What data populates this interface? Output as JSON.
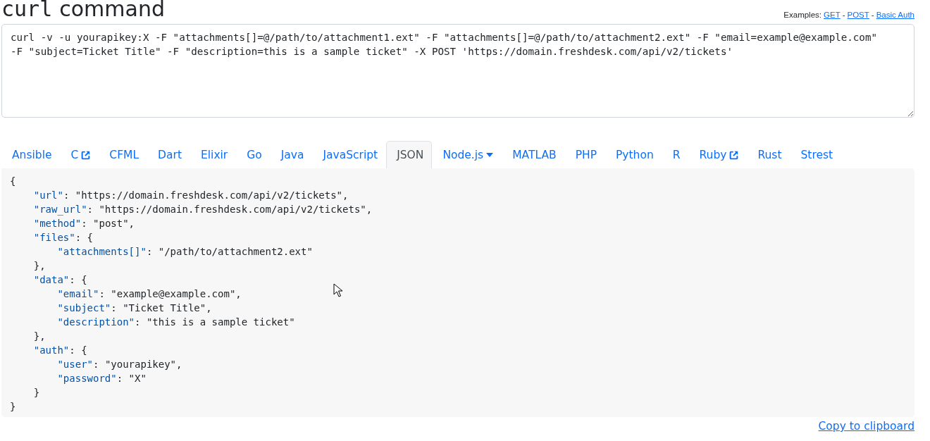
{
  "title": {
    "code": "curl",
    "text": "command"
  },
  "examples": {
    "label": "Examples:",
    "links": [
      "GET",
      "POST",
      "Basic Auth"
    ],
    "separator": "-"
  },
  "command": {
    "value": "curl -v -u yourapikey:X -F \"attachments[]=@/path/to/attachment1.ext\" -F \"attachments[]=@/path/to/attachment2.ext\" -F \"email=example@example.com\" -F \"subject=Ticket Title\" -F \"description=this is a sample ticket\" -X POST 'https://domain.freshdesk.com/api/v2/tickets'"
  },
  "tabs": [
    {
      "label": "Ansible",
      "kind": "plain",
      "selected": false
    },
    {
      "label": "C",
      "kind": "external",
      "selected": false
    },
    {
      "label": "CFML",
      "kind": "plain",
      "selected": false
    },
    {
      "label": "Dart",
      "kind": "plain",
      "selected": false
    },
    {
      "label": "Elixir",
      "kind": "plain",
      "selected": false
    },
    {
      "label": "Go",
      "kind": "plain",
      "selected": false
    },
    {
      "label": "Java",
      "kind": "plain",
      "selected": false
    },
    {
      "label": "JavaScript",
      "kind": "plain",
      "selected": false
    },
    {
      "label": "JSON",
      "kind": "plain",
      "selected": true
    },
    {
      "label": "Node.js",
      "kind": "dropdown",
      "selected": false
    },
    {
      "label": "MATLAB",
      "kind": "plain",
      "selected": false
    },
    {
      "label": "PHP",
      "kind": "plain",
      "selected": false
    },
    {
      "label": "Python",
      "kind": "plain",
      "selected": false
    },
    {
      "label": "R",
      "kind": "plain",
      "selected": false
    },
    {
      "label": "Ruby",
      "kind": "external",
      "selected": false
    },
    {
      "label": "Rust",
      "kind": "plain",
      "selected": false
    },
    {
      "label": "Strest",
      "kind": "plain",
      "selected": false
    }
  ],
  "output": {
    "code": "{\n    \"url\": \"https://domain.freshdesk.com/api/v2/tickets\",\n    \"raw_url\": \"https://domain.freshdesk.com/api/v2/tickets\",\n    \"method\": \"post\",\n    \"files\": {\n        \"attachments[]\": \"/path/to/attachment2.ext\"\n    },\n    \"data\": {\n        \"email\": \"example@example.com\",\n        \"subject\": \"Ticket Title\",\n        \"description\": \"this is a sample ticket\"\n    },\n    \"auth\": {\n        \"user\": \"yourapikey\",\n        \"password\": \"X\"\n    }\n}"
  },
  "copy_link": "Copy to clipboard"
}
